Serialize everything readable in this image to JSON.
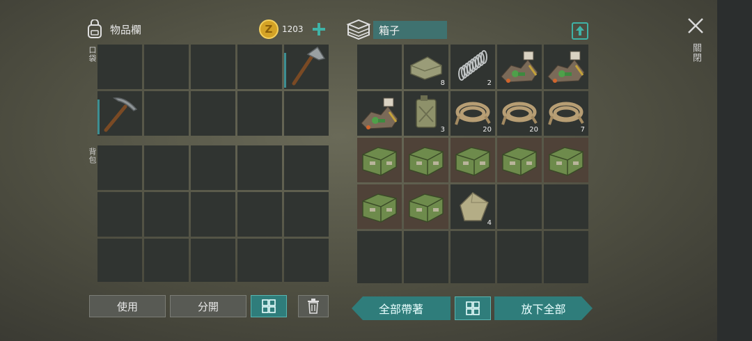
{
  "inventory": {
    "title": "物品欄",
    "currency": "1203",
    "pocket_label": "口袋",
    "backpack_label": "背包"
  },
  "container": {
    "name": "箱子",
    "items": [
      {
        "icon": "empty",
        "qty": ""
      },
      {
        "icon": "cloth-icon",
        "qty": "8"
      },
      {
        "icon": "spring-icon",
        "qty": "2"
      },
      {
        "icon": "scrap-pile-icon",
        "qty": ""
      },
      {
        "icon": "scrap-pile-icon",
        "qty": ""
      },
      {
        "icon": "scrap-pile-icon",
        "qty": ""
      },
      {
        "icon": "jerrycan-icon",
        "qty": "3"
      },
      {
        "icon": "rope-icon",
        "qty": "20"
      },
      {
        "icon": "rope-icon",
        "qty": "20"
      },
      {
        "icon": "rope-icon",
        "qty": "7"
      },
      {
        "icon": "crate-icon",
        "qty": ""
      },
      {
        "icon": "crate-icon",
        "qty": ""
      },
      {
        "icon": "crate-icon",
        "qty": ""
      },
      {
        "icon": "crate-icon",
        "qty": ""
      },
      {
        "icon": "crate-icon",
        "qty": ""
      },
      {
        "icon": "crate-icon",
        "qty": ""
      },
      {
        "icon": "crate-icon",
        "qty": ""
      },
      {
        "icon": "sack-icon",
        "qty": "4"
      },
      {
        "icon": "empty",
        "qty": ""
      },
      {
        "icon": "empty",
        "qty": ""
      },
      {
        "icon": "empty",
        "qty": ""
      },
      {
        "icon": "empty",
        "qty": ""
      },
      {
        "icon": "empty",
        "qty": ""
      },
      {
        "icon": "empty",
        "qty": ""
      },
      {
        "icon": "empty",
        "qty": ""
      }
    ]
  },
  "buttons": {
    "use": "使用",
    "split": "分開",
    "take_all": "全部帶著",
    "drop_all": "放下全部",
    "close": "關閉"
  },
  "colors": {
    "accent": "#2f7d7b",
    "slot": "#303431",
    "crate_slot": "#4f4238"
  }
}
